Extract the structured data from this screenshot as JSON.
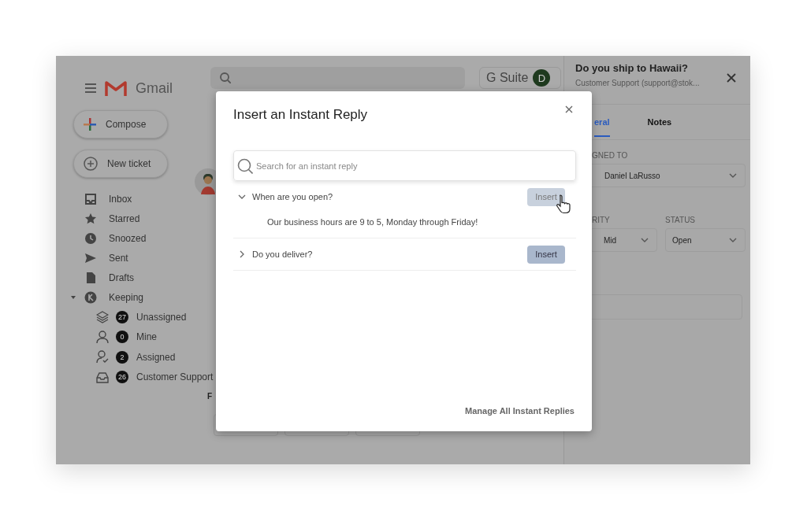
{
  "app": {
    "name": "Gmail",
    "compose": "Compose",
    "new_ticket": "New ticket",
    "suite_label": "G Suite",
    "account_initial": "D",
    "cut_letter": "F"
  },
  "sidebar": {
    "items": [
      {
        "label": "Inbox"
      },
      {
        "label": "Starred"
      },
      {
        "label": "Snoozed"
      },
      {
        "label": "Sent"
      },
      {
        "label": "Drafts"
      },
      {
        "label": "Keeping",
        "expanded": true,
        "children": [
          {
            "label": "Unassigned",
            "count": "27"
          },
          {
            "label": "Mine",
            "count": "0"
          },
          {
            "label": "Assigned",
            "count": "2"
          },
          {
            "label": "Customer Support",
            "count": "26"
          }
        ]
      }
    ]
  },
  "ticket_panel": {
    "title": "Do you ship to Hawaii?",
    "subtitle": "Customer Support (support@stok...",
    "tabs": [
      {
        "label": "eral",
        "selected": true
      },
      {
        "label": "Notes",
        "selected": false
      }
    ],
    "assigned_label": "GNED TO",
    "assignee": "Daniel LaRusso",
    "priority_label": "RITY",
    "priority": "Mid",
    "status_label": "STATUS",
    "status": "Open"
  },
  "dialog": {
    "title": "Insert an Instant Reply",
    "search": {
      "placeholder": "Search for an instant reply"
    },
    "replies": [
      {
        "question": "When are you open?",
        "expanded": true,
        "answer": "Our business hours are 9 to 5, Monday through Friday!",
        "button": "Insert",
        "hovered": true
      },
      {
        "question": "Do you deliver?",
        "expanded": false,
        "button": "Insert",
        "hovered": false
      }
    ],
    "footer_link": "Manage All Instant Replies"
  }
}
